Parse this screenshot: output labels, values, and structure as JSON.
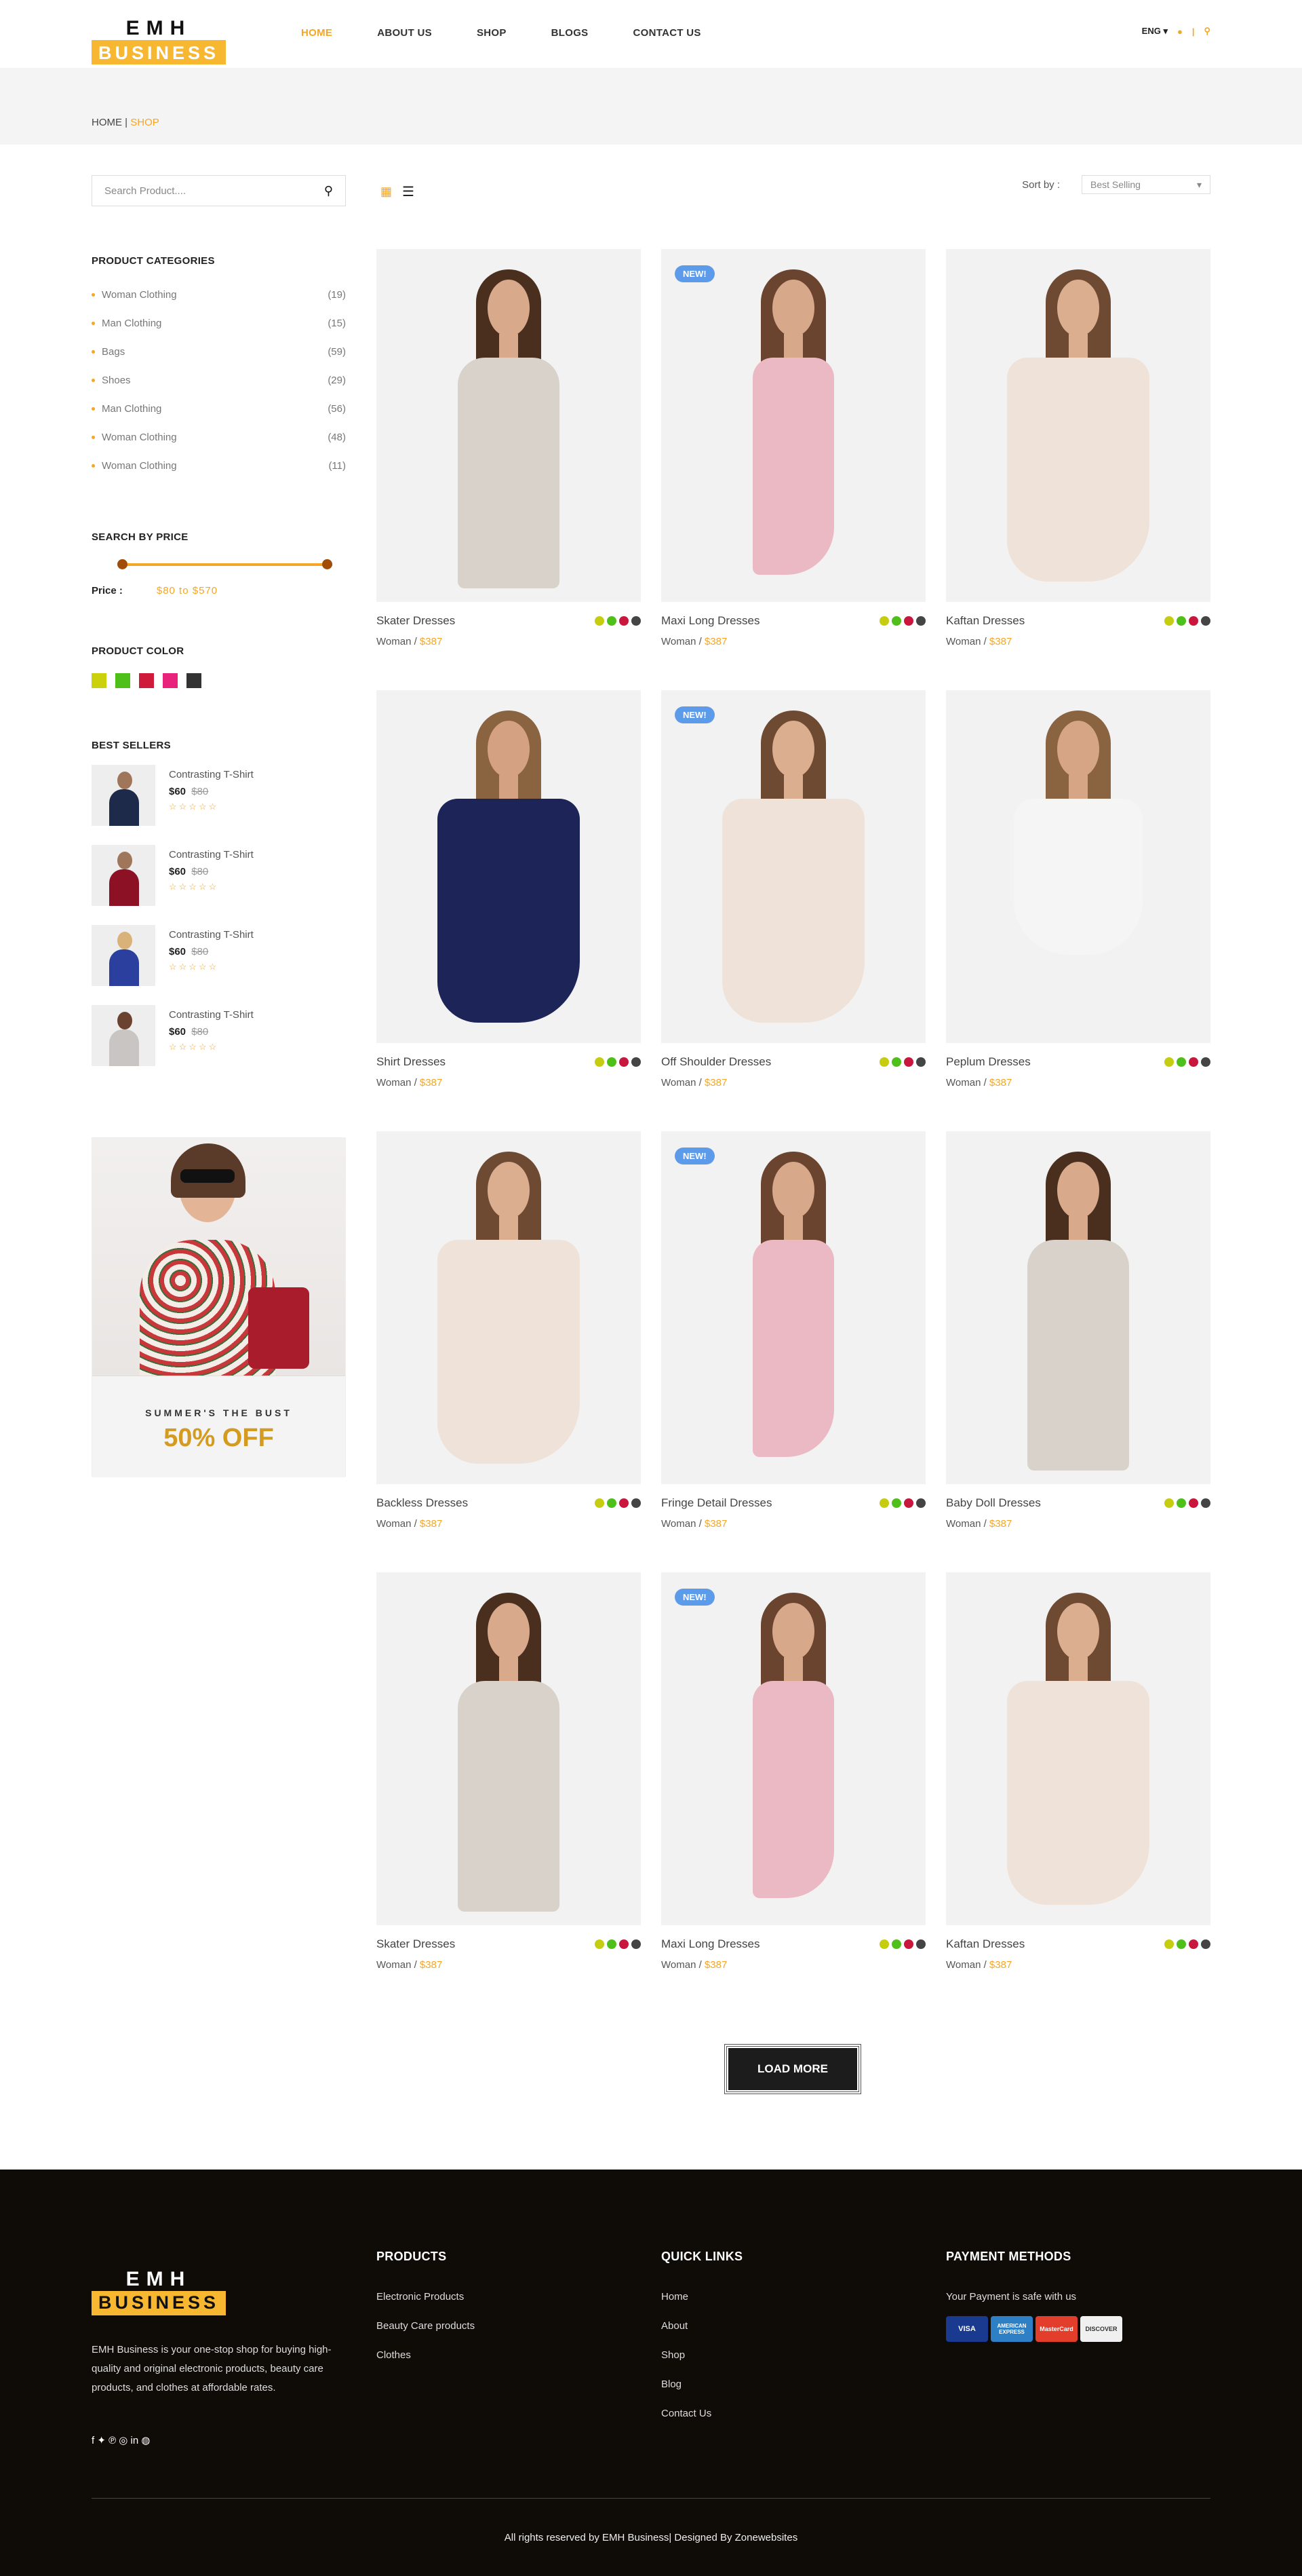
{
  "brand": {
    "line1": "EMH",
    "line2": "BUSINESS"
  },
  "nav": [
    "HOME",
    "ABOUT US",
    "SHOP",
    "BLOGS",
    "CONTACT US"
  ],
  "lang": "ENG",
  "breadcrumb": {
    "home": "HOME",
    "sep": " | ",
    "current": "SHOP"
  },
  "search": {
    "placeholder": "Search Product...."
  },
  "categories": {
    "title": "PRODUCT CATEGORIES",
    "items": [
      {
        "name": "Woman Clothing",
        "count": "(19)"
      },
      {
        "name": "Man Clothing",
        "count": "(15)"
      },
      {
        "name": "Bags",
        "count": "(59)"
      },
      {
        "name": "Shoes",
        "count": "(29)"
      },
      {
        "name": "Man Clothing",
        "count": "(56)"
      },
      {
        "name": "Woman Clothing",
        "count": "(48)"
      },
      {
        "name": "Woman Clothing",
        "count": "(11)"
      }
    ]
  },
  "price": {
    "title": "SEARCH BY PRICE",
    "label": "Price :",
    "range": "$80  to  $570"
  },
  "colors": {
    "title": "PRODUCT COLOR",
    "swatches": [
      "#cbd10a",
      "#4fc01a",
      "#d01a3c",
      "#e9237c",
      "#333333"
    ]
  },
  "bestsellers": {
    "title": "BEST SELLERS",
    "items": [
      {
        "name": "Contrasting T-Shirt",
        "price": "$60",
        "old": "$80",
        "stars": "☆☆☆☆☆"
      },
      {
        "name": "Contrasting T-Shirt",
        "price": "$60",
        "old": "$80",
        "stars": "☆☆☆☆☆"
      },
      {
        "name": "Contrasting T-Shirt",
        "price": "$60",
        "old": "$80",
        "stars": "☆☆☆☆☆"
      },
      {
        "name": "Contrasting T-Shirt",
        "price": "$60",
        "old": "$80",
        "stars": "☆☆☆☆☆"
      }
    ]
  },
  "promo": {
    "line1": "SUMMER'S THE BUST",
    "pct": "50%",
    "off": " OFF"
  },
  "sort": {
    "label": "Sort by :",
    "value": "Best Selling"
  },
  "products": [
    {
      "name": "Skater Dresses",
      "cat": "Woman / ",
      "price": "$387",
      "badge": ""
    },
    {
      "name": "Maxi Long Dresses",
      "cat": "Woman / ",
      "price": "$387",
      "badge": "NEW!"
    },
    {
      "name": "Kaftan Dresses",
      "cat": "Woman / ",
      "price": "$387",
      "badge": ""
    },
    {
      "name": "Shirt Dresses",
      "cat": "Woman / ",
      "price": "$387",
      "badge": ""
    },
    {
      "name": "Off Shoulder Dresses",
      "cat": "Woman / ",
      "price": "$387",
      "badge": "NEW!"
    },
    {
      "name": "Peplum Dresses",
      "cat": "Woman / ",
      "price": "$387",
      "badge": ""
    },
    {
      "name": "Backless Dresses",
      "cat": "Woman / ",
      "price": "$387",
      "badge": ""
    },
    {
      "name": "Fringe Detail Dresses",
      "cat": "Woman / ",
      "price": "$387",
      "badge": "NEW!"
    },
    {
      "name": "Baby Doll Dresses",
      "cat": "Woman / ",
      "price": "$387",
      "badge": ""
    },
    {
      "name": "Skater Dresses",
      "cat": "Woman / ",
      "price": "$387",
      "badge": ""
    },
    {
      "name": "Maxi Long Dresses",
      "cat": "Woman / ",
      "price": "$387",
      "badge": "NEW!"
    },
    {
      "name": "Kaftan Dresses",
      "cat": "Woman / ",
      "price": "$387",
      "badge": ""
    }
  ],
  "dot_colors": [
    "#c6cc10",
    "#4fc01a",
    "#c8163c",
    "#444444"
  ],
  "load_more": "LOAD MORE",
  "footer": {
    "desc": "EMH Business is your one-stop shop for buying high-quality and original electronic products, beauty care products, and clothes at affordable rates.",
    "social": "f  ✦  ℗  ◎  in  ◍",
    "products": {
      "title": "PRODUCTS",
      "items": [
        "Electronic Products",
        "Beauty Care products",
        "Clothes"
      ]
    },
    "quick": {
      "title": "QUICK LINKS",
      "items": [
        "Home",
        "About",
        "Shop",
        "Blog",
        "Contact Us"
      ]
    },
    "payment": {
      "title": "PAYMENT METHODS",
      "text": "Your Payment is safe with us",
      "cards": [
        "VISA",
        "AMERICAN EXPRESS",
        "MasterCard",
        "DISCOVER"
      ]
    },
    "copyright": "All rights reserved by EMH Business| Designed By Zonewebsites"
  }
}
